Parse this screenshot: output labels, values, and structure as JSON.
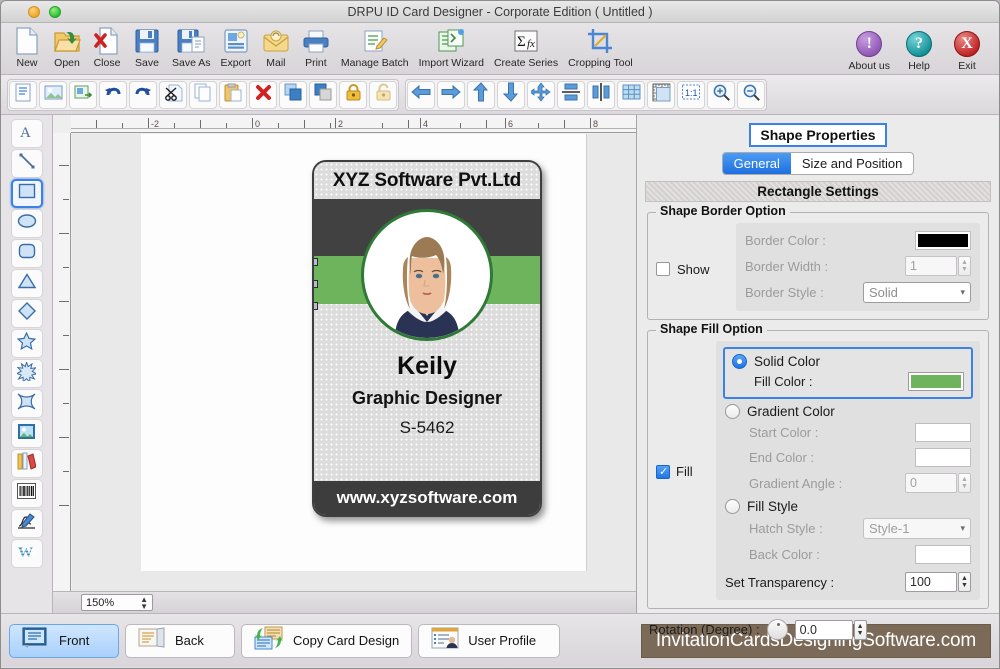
{
  "window": {
    "title": "DRPU ID Card Designer - Corporate Edition ( Untitled )",
    "traffic_lights": [
      "minimize",
      "zoom"
    ]
  },
  "toolbar": {
    "items": [
      {
        "label": "New",
        "icon": "new-document-icon"
      },
      {
        "label": "Open",
        "icon": "open-folder-icon"
      },
      {
        "label": "Close",
        "icon": "close-document-icon"
      },
      {
        "label": "Save",
        "icon": "save-floppy-icon"
      },
      {
        "label": "Save As",
        "icon": "save-as-floppy-icon"
      },
      {
        "label": "Export",
        "icon": "export-icon"
      },
      {
        "label": "Mail",
        "icon": "mail-envelope-icon"
      },
      {
        "label": "Print",
        "icon": "printer-icon"
      },
      {
        "label": "Manage Batch",
        "icon": "manage-batch-icon"
      },
      {
        "label": "Import Wizard",
        "icon": "import-wizard-icon"
      },
      {
        "label": "Create Series",
        "icon": "create-series-sigma-icon"
      },
      {
        "label": "Cropping Tool",
        "icon": "cropping-tool-icon"
      }
    ],
    "right_items": [
      {
        "label": "About us",
        "icon": "about-exclamation-icon",
        "glyph": "!",
        "color": "#8e56b4"
      },
      {
        "label": "Help",
        "icon": "help-question-icon",
        "glyph": "?",
        "color": "#128f96"
      },
      {
        "label": "Exit",
        "icon": "exit-close-icon",
        "glyph": "X",
        "color": "#c01f21"
      }
    ]
  },
  "toolbar2": {
    "groups": [
      {
        "buttons": [
          {
            "name": "add-text-icon"
          },
          {
            "name": "add-image-icon"
          },
          {
            "name": "insert-object-icon"
          },
          {
            "name": "undo-icon"
          },
          {
            "name": "redo-icon"
          },
          {
            "name": "cut-scissors-icon"
          },
          {
            "name": "copy-icon"
          },
          {
            "name": "paste-clipboard-icon"
          },
          {
            "name": "delete-cross-icon"
          },
          {
            "name": "bring-to-front-icon"
          },
          {
            "name": "send-to-back-icon"
          },
          {
            "name": "lock-icon"
          },
          {
            "name": "unlock-icon"
          }
        ]
      },
      {
        "buttons": [
          {
            "name": "align-left-arrow-icon"
          },
          {
            "name": "align-right-arrow-icon"
          },
          {
            "name": "align-top-arrow-icon"
          },
          {
            "name": "align-bottom-arrow-icon"
          },
          {
            "name": "align-center-icon"
          },
          {
            "name": "distribute-vertical-icon"
          },
          {
            "name": "distribute-horizontal-icon"
          },
          {
            "name": "grid-icon"
          },
          {
            "name": "ruler-icon"
          },
          {
            "name": "actual-size-1-1-icon"
          },
          {
            "name": "zoom-in-icon"
          },
          {
            "name": "zoom-out-icon"
          }
        ]
      }
    ]
  },
  "palette": {
    "tools": [
      {
        "name": "text-tool",
        "icon": "letter-a-icon",
        "selected": false
      },
      {
        "name": "line-tool",
        "icon": "line-icon",
        "selected": false
      },
      {
        "name": "rectangle-tool",
        "icon": "rectangle-icon",
        "selected": true
      },
      {
        "name": "ellipse-tool",
        "icon": "ellipse-icon",
        "selected": false
      },
      {
        "name": "rounded-rect-tool",
        "icon": "rounded-rect-icon",
        "selected": false
      },
      {
        "name": "triangle-tool",
        "icon": "triangle-icon",
        "selected": false
      },
      {
        "name": "diamond-tool",
        "icon": "diamond-icon",
        "selected": false
      },
      {
        "name": "star-tool",
        "icon": "star-icon",
        "selected": false
      },
      {
        "name": "burst-tool",
        "icon": "burst-icon",
        "selected": false
      },
      {
        "name": "four-point-star-tool",
        "icon": "four-point-star-icon",
        "selected": false
      },
      {
        "name": "image-tool",
        "icon": "picture-icon",
        "selected": false
      },
      {
        "name": "library-tool",
        "icon": "books-icon",
        "selected": false
      },
      {
        "name": "barcode-tool",
        "icon": "barcode-icon",
        "selected": false
      },
      {
        "name": "signature-tool",
        "icon": "pen-signature-icon",
        "selected": false
      },
      {
        "name": "watermark-tool",
        "icon": "watermark-w-icon",
        "selected": false
      }
    ]
  },
  "canvas": {
    "ruler_h_labels": [
      "-2",
      "0",
      "2",
      "4",
      "6",
      "8"
    ],
    "zoom_value": "150%",
    "card": {
      "company": "XYZ Software Pvt.Ltd",
      "name": "Keily",
      "designation": "Graphic Designer",
      "employee_id": "S-5462",
      "website": "www.xyzsoftware.com",
      "band_dark_color": "#414141",
      "band_green_color": "#6eb45c",
      "photo_ring_color": "#2e7a36"
    }
  },
  "properties": {
    "title": "Shape Properties",
    "tabs": [
      {
        "label": "General",
        "active": true
      },
      {
        "label": "Size and Position",
        "active": false
      }
    ],
    "section_title": "Rectangle Settings",
    "border": {
      "legend": "Shape Border Option",
      "show_label": "Show",
      "show_checked": false,
      "color_label": "Border Color :",
      "color_value": "#000000",
      "width_label": "Border Width :",
      "width_value": "1",
      "style_label": "Border Style :",
      "style_value": "Solid"
    },
    "fill": {
      "legend": "Shape Fill Option",
      "fill_label": "Fill",
      "fill_checked": true,
      "solid": {
        "label": "Solid Color",
        "selected": true,
        "fill_color_label": "Fill Color :",
        "fill_color_value": "#6eb45c"
      },
      "gradient": {
        "label": "Gradient Color",
        "selected": false,
        "start_color_label": "Start Color :",
        "start_color_value": "#ffffff",
        "end_color_label": "End Color :",
        "end_color_value": "#ffffff",
        "angle_label": "Gradient Angle :",
        "angle_value": "0"
      },
      "fill_style": {
        "label": "Fill Style",
        "selected": false,
        "hatch_label": "Hatch Style :",
        "hatch_value": "Style-1",
        "back_color_label": "Back Color :",
        "back_color_value": "#ffffff"
      },
      "transparency_label": "Set Transparency :",
      "transparency_value": "100"
    },
    "rotation_label": "Rotation (Degree) :",
    "rotation_value": "0.0"
  },
  "bottombar": {
    "buttons": [
      {
        "label": "Front",
        "icon": "card-front-icon",
        "active": true
      },
      {
        "label": "Back",
        "icon": "card-back-icon",
        "active": false
      },
      {
        "label": "Copy Card Design",
        "icon": "copy-card-icon",
        "active": false
      },
      {
        "label": "User Profile",
        "icon": "user-profile-icon",
        "active": false
      }
    ],
    "brand": "InvitationCardsDesigningSoftware.com"
  }
}
